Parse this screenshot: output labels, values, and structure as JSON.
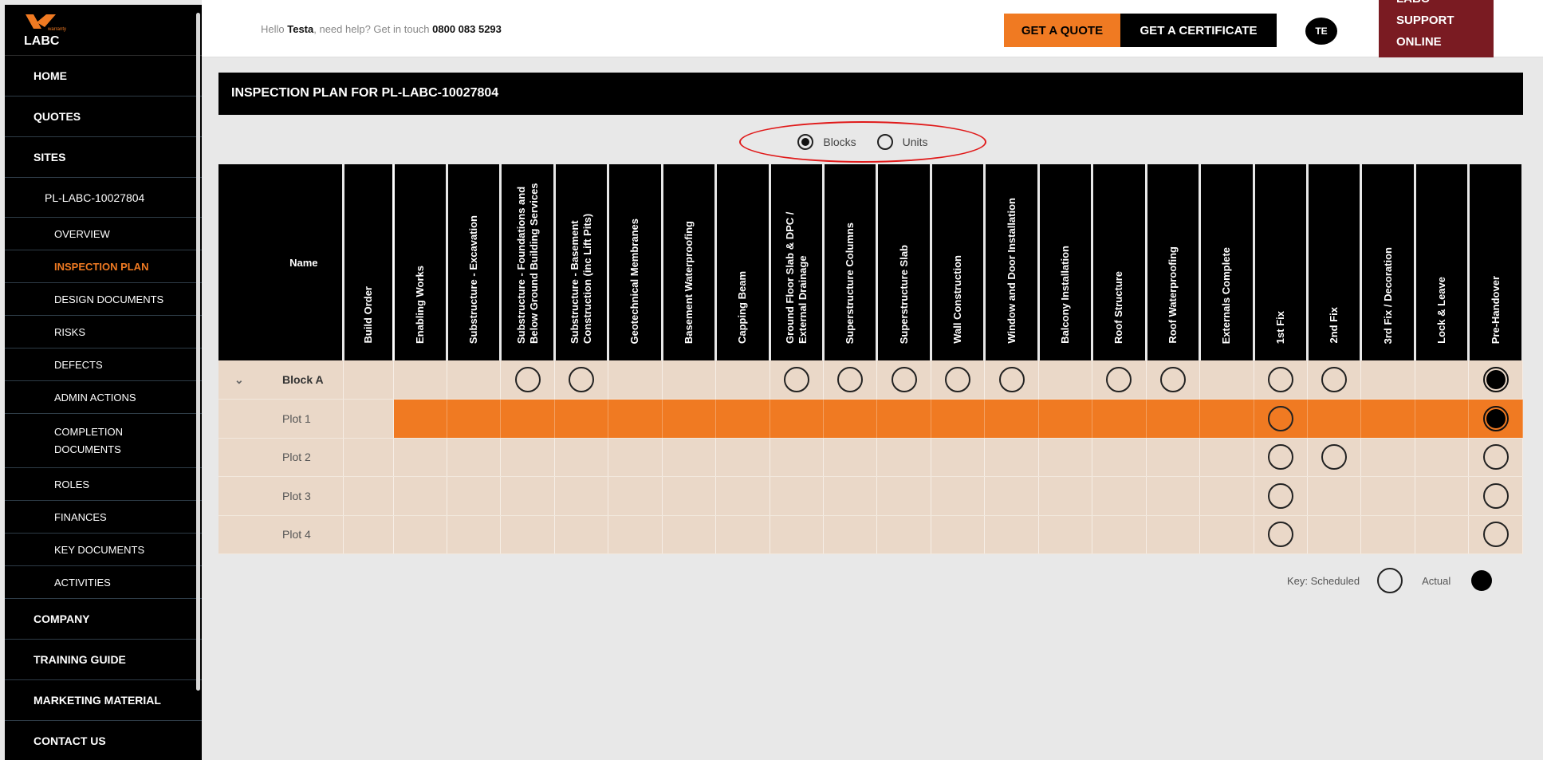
{
  "brand": {
    "logo_small": "warranty",
    "logo_text": "LABC"
  },
  "sidebar": {
    "top_items": [
      {
        "label": "HOME"
      },
      {
        "label": "QUOTES"
      },
      {
        "label": "SITES"
      }
    ],
    "site": {
      "label": "PL-LABC-10027804"
    },
    "sub_items": [
      {
        "label": "OVERVIEW"
      },
      {
        "label": "INSPECTION PLAN"
      },
      {
        "label": "DESIGN DOCUMENTS"
      },
      {
        "label": "RISKS"
      },
      {
        "label": "DEFECTS"
      },
      {
        "label": "ADMIN ACTIONS"
      },
      {
        "label": "COMPLETION DOCUMENTS"
      },
      {
        "label": "ROLES"
      },
      {
        "label": "FINANCES"
      },
      {
        "label": "KEY DOCUMENTS"
      },
      {
        "label": "ACTIVITIES"
      }
    ],
    "bottom_items": [
      {
        "label": "COMPANY"
      },
      {
        "label": "TRAINING GUIDE"
      },
      {
        "label": "MARKETING MATERIAL"
      },
      {
        "label": "CONTACT US"
      }
    ]
  },
  "header": {
    "greeting_prefix": "Hello ",
    "user_name": "Testa",
    "greeting_mid": ", need help? Get in touch ",
    "phone": "0800 083 5293",
    "quote_button": "GET A QUOTE",
    "certificate_button": "GET A CERTIFICATE",
    "avatar_initials": "TE",
    "support_lines": [
      "LABC",
      "SUPPORT",
      "ONLINE"
    ]
  },
  "page": {
    "title": "INSPECTION PLAN FOR PL-LABC-10027804",
    "view_toggle": {
      "options": [
        "Blocks",
        "Units"
      ],
      "selected": "Blocks"
    }
  },
  "table": {
    "name_header": "Name",
    "order_header": "Build Order",
    "stages": [
      "Enabling Works",
      "Substructure - Excavation",
      "Substructure - Foundations and Below Ground Building Services",
      "Substructure - Basement Construction (inc Lift Pits)",
      "Geotechnical Membranes",
      "Basement Waterproofing",
      "Capping Beam",
      "Ground Floor Slab & DPC / External Drainage",
      "Superstructure Columns",
      "Superstructure Slab",
      "Wall Construction",
      "Window and Door Installation",
      "Balcony Installation",
      "Roof Structure",
      "Roof Waterproofing",
      "Externals Complete",
      "1st Fix",
      "2nd Fix",
      "3rd Fix / Decoration",
      "Lock & Leave",
      "Pre-Handover"
    ],
    "rows": [
      {
        "name": "Block A",
        "type": "block",
        "cells": [
          "",
          "",
          "S",
          "S",
          "",
          "",
          "",
          "S",
          "S",
          "S",
          "S",
          "S",
          "",
          "S",
          "S",
          "",
          "S",
          "S",
          "",
          "",
          "A"
        ]
      },
      {
        "name": "Plot 1",
        "type": "highlight",
        "cells": [
          "",
          "",
          "",
          "",
          "",
          "",
          "",
          "",
          "",
          "",
          "",
          "",
          "",
          "",
          "",
          "",
          "S",
          "",
          "",
          "",
          "A"
        ]
      },
      {
        "name": "Plot 2",
        "type": "plot",
        "cells": [
          "",
          "",
          "",
          "",
          "",
          "",
          "",
          "",
          "",
          "",
          "",
          "",
          "",
          "",
          "",
          "",
          "S",
          "S",
          "",
          "",
          "S"
        ]
      },
      {
        "name": "Plot 3",
        "type": "plot",
        "cells": [
          "",
          "",
          "",
          "",
          "",
          "",
          "",
          "",
          "",
          "",
          "",
          "",
          "",
          "",
          "",
          "",
          "S",
          "",
          "",
          "",
          "S"
        ]
      },
      {
        "name": "Plot 4",
        "type": "plot",
        "cells": [
          "",
          "",
          "",
          "",
          "",
          "",
          "",
          "",
          "",
          "",
          "",
          "",
          "",
          "",
          "",
          "",
          "S",
          "",
          "",
          "",
          "S"
        ]
      }
    ]
  },
  "key": {
    "scheduled_label": "Key: Scheduled",
    "actual_label": "Actual"
  },
  "colors": {
    "accent": "#f07a22",
    "support": "#7a1b22",
    "row_bg": "#ead8c8",
    "highlight_ring": "#e01a1a"
  }
}
